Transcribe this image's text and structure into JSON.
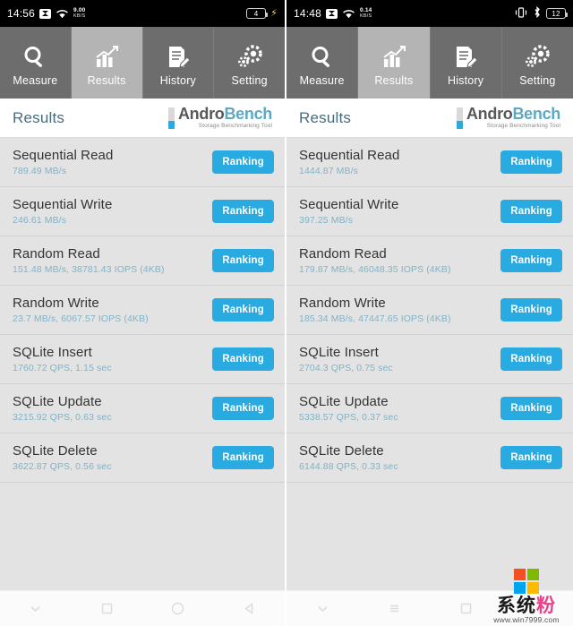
{
  "app": {
    "brand_name_part1": "Andro",
    "brand_name_part2": "Bench",
    "brand_tagline": "Storage Benchmarking Tool",
    "accent_blue": "#29abe2",
    "value_blue": "#7fb3c8",
    "tab_bg": "#6d6d6d",
    "tab_active_bg": "#b4b4b4",
    "list_bg": "#e3e3e3"
  },
  "tabs": [
    {
      "label": "Measure",
      "icon": "magnifier-icon",
      "active": false
    },
    {
      "label": "Results",
      "icon": "bar-chart-icon",
      "active": true
    },
    {
      "label": "History",
      "icon": "document-pencil-icon",
      "active": false
    },
    {
      "label": "Setting",
      "icon": "gears-icon",
      "active": false
    }
  ],
  "header": {
    "title": "Results"
  },
  "ranking_label": "Ranking",
  "left": {
    "status": {
      "clock": "14:56",
      "net_rate_value": "9.00",
      "net_rate_unit": "KB/S",
      "battery_level": "4",
      "charging": true,
      "icons": [
        "cast-icon",
        "wifi-icon",
        "battery-icon",
        "bolt-icon"
      ]
    },
    "rows": [
      {
        "title": "Sequential Read",
        "value": "789.49 MB/s"
      },
      {
        "title": "Sequential Write",
        "value": "246.61 MB/s"
      },
      {
        "title": "Random Read",
        "value": "151.48 MB/s, 38781.43 IOPS (4KB)"
      },
      {
        "title": "Random Write",
        "value": "23.7 MB/s, 6067.57 IOPS (4KB)"
      },
      {
        "title": "SQLite Insert",
        "value": "1760.72 QPS, 1.15 sec"
      },
      {
        "title": "SQLite Update",
        "value": "3215.92 QPS, 0.63 sec"
      },
      {
        "title": "SQLite Delete",
        "value": "3622.87 QPS, 0.56 sec"
      }
    ],
    "nav": [
      "chevron-down-icon",
      "square-icon",
      "circle-icon",
      "back-triangle-icon"
    ]
  },
  "right": {
    "status": {
      "clock": "14:48",
      "net_rate_value": "0.14",
      "net_rate_unit": "KB/S",
      "battery_level": "12",
      "charging": false,
      "icons": [
        "cast-icon",
        "wifi-icon",
        "vibrate-icon",
        "bluetooth-icon",
        "battery-icon"
      ]
    },
    "rows": [
      {
        "title": "Sequential Read",
        "value": "1444.87 MB/s"
      },
      {
        "title": "Sequential Write",
        "value": "397.25 MB/s"
      },
      {
        "title": "Random Read",
        "value": "179.87 MB/s, 46048.35 IOPS (4KB)"
      },
      {
        "title": "Random Write",
        "value": "185.34 MB/s, 47447.65 IOPS (4KB)"
      },
      {
        "title": "SQLite Insert",
        "value": "2704.3 QPS, 0.75 sec"
      },
      {
        "title": "SQLite Update",
        "value": "5338.57 QPS, 0.37 sec"
      },
      {
        "title": "SQLite Delete",
        "value": "6144.88 QPS, 0.33 sec"
      }
    ],
    "nav": [
      "chevron-down-icon",
      "menu-icon",
      "square-icon"
    ]
  },
  "watermark": {
    "title": "系统粉",
    "title_plain": "系统",
    "title_accent": "粉",
    "url": "www.win7999.com",
    "square_colors": [
      "#f25022",
      "#7fba00",
      "#00a4ef",
      "#ffb900"
    ]
  }
}
